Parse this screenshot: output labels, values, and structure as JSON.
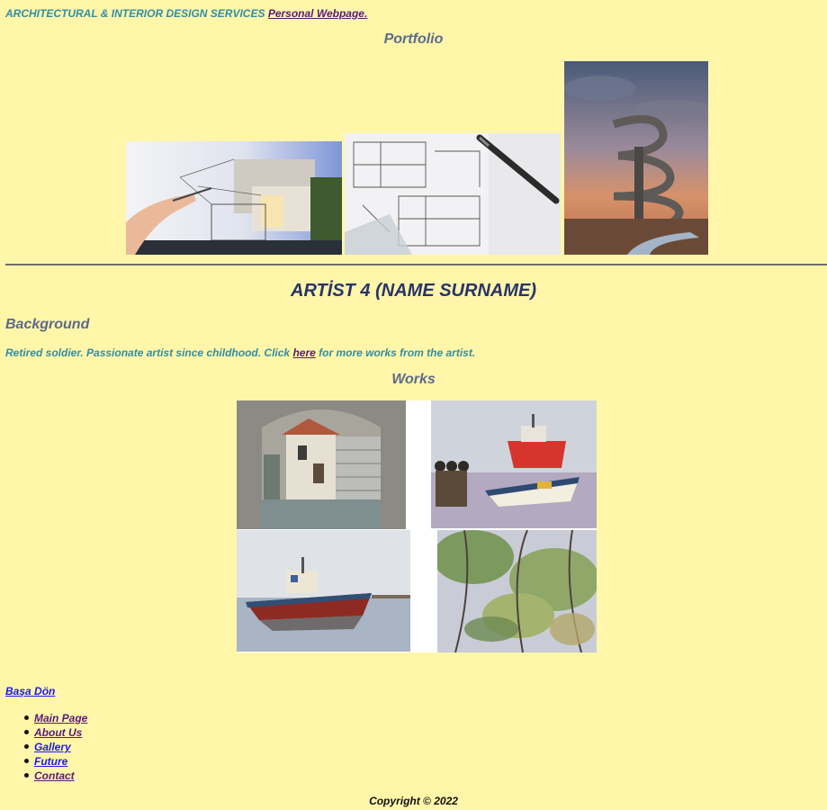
{
  "header": {
    "tagline": "ARCHITECTURAL & INTERIOR DESIGN SERVICES",
    "link_label": "Personal Webpage."
  },
  "portfolio": {
    "heading": "Portfolio",
    "images": [
      {
        "name": "architect-sketch-photo"
      },
      {
        "name": "blueprint-pen-photo"
      },
      {
        "name": "spiral-tower-photo"
      }
    ]
  },
  "artist": {
    "title": "ARTİST 4 (NAME SURNAME)",
    "background_heading": "Background",
    "bio_before": "Retired soldier. Passionate artist since childhood. Click ",
    "bio_link": "here",
    "bio_after": " for more works from the artist."
  },
  "works": {
    "heading": "Works",
    "paintings": [
      {
        "name": "painting-stone-alley"
      },
      {
        "name": "painting-red-boats"
      },
      {
        "name": "painting-fishing-boat"
      },
      {
        "name": "painting-willow-trees"
      }
    ]
  },
  "footer": {
    "back_link": "Başa Dön",
    "nav_items": [
      "Main Page",
      "About Us",
      "Gallery",
      "Future",
      "Contact"
    ],
    "copyright": "Copyright © 2022"
  },
  "colors": {
    "background": "#fff6aa",
    "tagline_teal": "#2f8ea8",
    "heading_slate": "#5c6a8c",
    "title_navy": "#283469",
    "visited_link": "#5a1a7a",
    "link_blue": "#1a1aee"
  }
}
